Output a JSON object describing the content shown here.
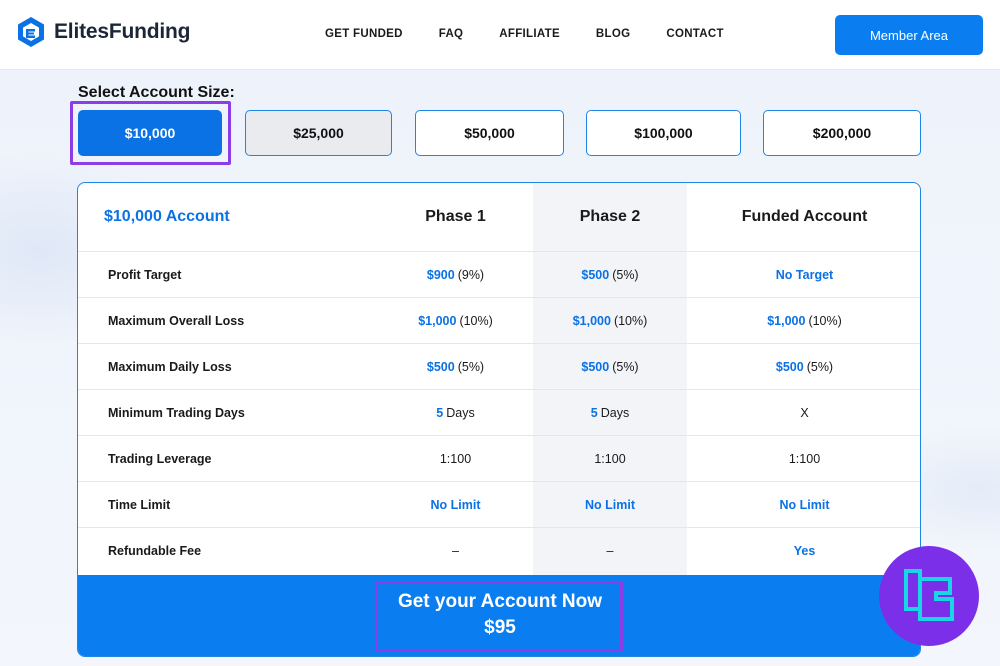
{
  "header": {
    "brand": "ElitesFunding",
    "nav": [
      "GET FUNDED",
      "FAQ",
      "AFFILIATE",
      "BLOG",
      "CONTACT"
    ],
    "member_button": "Member Area"
  },
  "account_size": {
    "label": "Select Account Size:",
    "options": [
      "$10,000",
      "$25,000",
      "$50,000",
      "$100,000",
      "$200,000"
    ],
    "selected": "$10,000"
  },
  "table": {
    "title": "$10,000 Account",
    "columns": [
      "Phase 1",
      "Phase 2",
      "Funded Account"
    ],
    "rows": [
      {
        "label": "Profit Target",
        "cells": [
          [
            "$900",
            "(9%)"
          ],
          [
            "$500",
            "(5%)"
          ],
          [
            "No Target",
            ""
          ]
        ]
      },
      {
        "label": "Maximum Overall Loss",
        "cells": [
          [
            "$1,000",
            "(10%)"
          ],
          [
            "$1,000",
            "(10%)"
          ],
          [
            "$1,000",
            "(10%)"
          ]
        ]
      },
      {
        "label": "Maximum Daily Loss",
        "cells": [
          [
            "$500",
            "(5%)"
          ],
          [
            "$500",
            "(5%)"
          ],
          [
            "$500",
            "(5%)"
          ]
        ]
      },
      {
        "label": "Minimum Trading Days",
        "cells": [
          [
            "5",
            "Days"
          ],
          [
            "5",
            "Days"
          ],
          [
            "",
            "X"
          ]
        ]
      },
      {
        "label": "Trading Leverage",
        "cells": [
          [
            "",
            "1:100"
          ],
          [
            "",
            "1:100"
          ],
          [
            "",
            "1:100"
          ]
        ]
      },
      {
        "label": "Time Limit",
        "cells": [
          [
            "No Limit",
            ""
          ],
          [
            "No Limit",
            ""
          ],
          [
            "No Limit",
            ""
          ]
        ]
      },
      {
        "label": "Refundable Fee",
        "cells": [
          [
            "",
            "–"
          ],
          [
            "",
            "–"
          ],
          [
            "Yes",
            ""
          ]
        ]
      }
    ]
  },
  "cta": {
    "line1": "Get your Account Now",
    "line2": "$95"
  },
  "colors": {
    "accent": "#0a7ef0",
    "highlight": "#8b3ee6",
    "badge": "#7c2fe8"
  }
}
